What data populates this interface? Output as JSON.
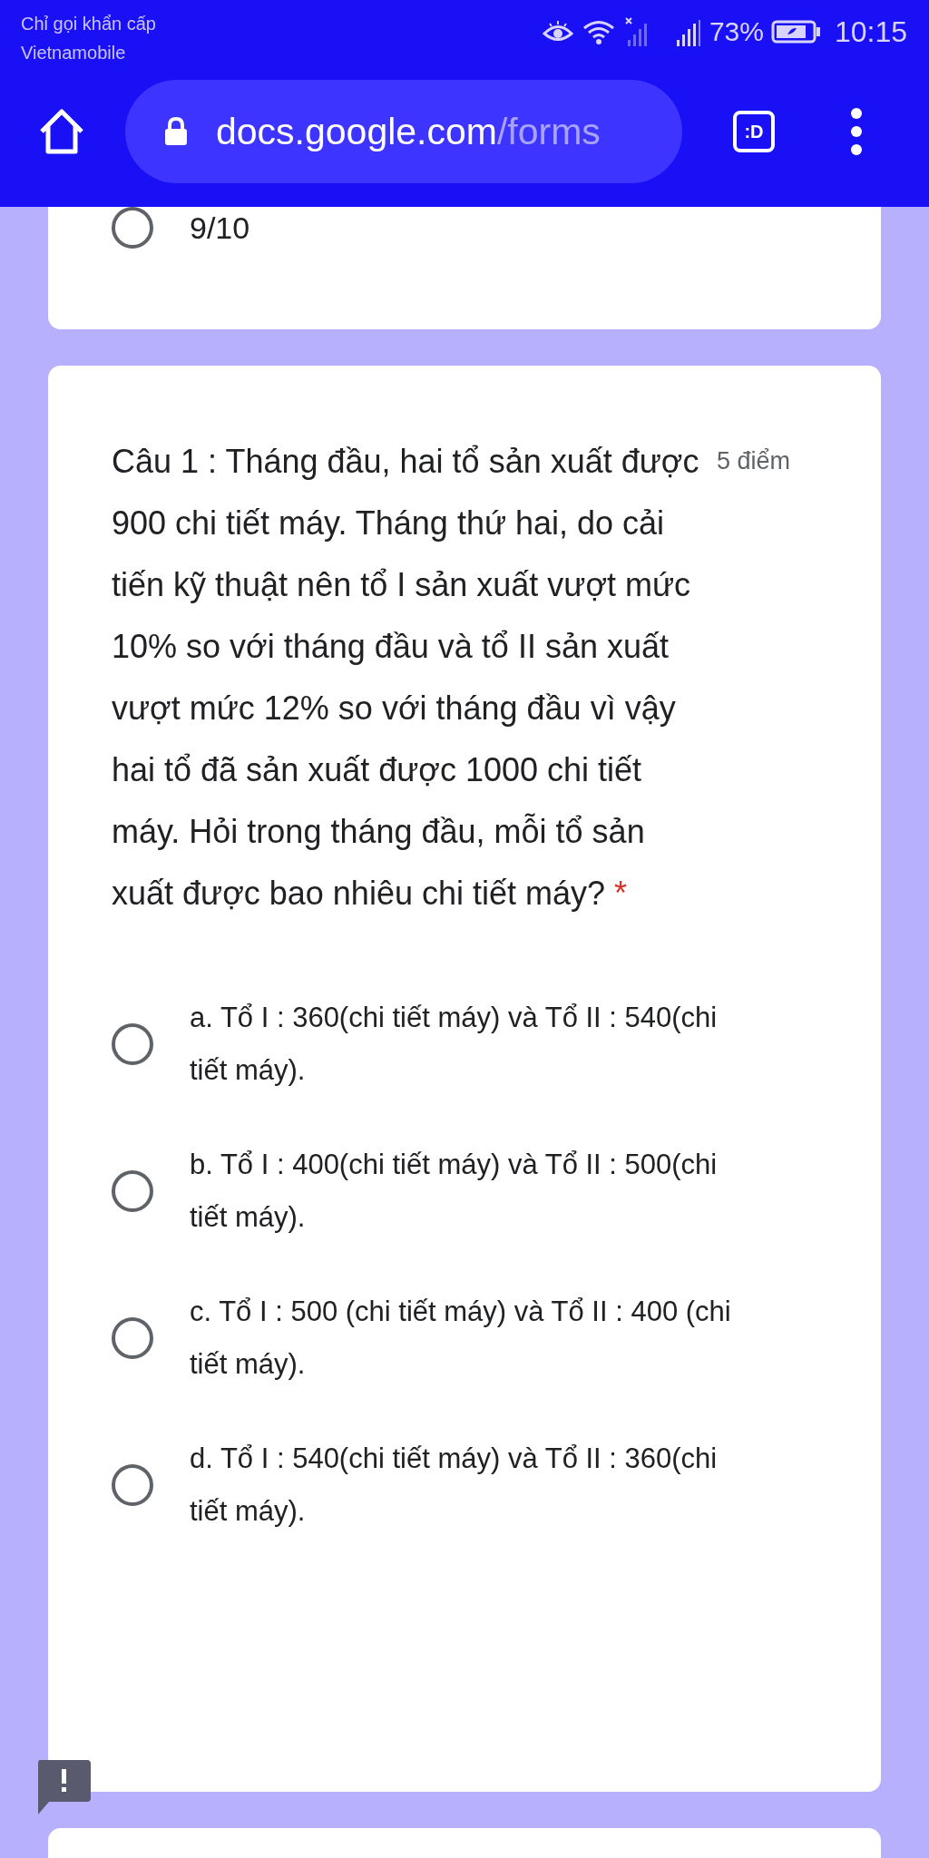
{
  "status_bar": {
    "carrier_lines": [
      "Chỉ gọi khẩn cấp",
      "Vietnamobile"
    ],
    "battery_text": "73%",
    "time": "10:15"
  },
  "browser": {
    "url_domain": "docs.google.com",
    "url_path": "/forms",
    "tab_count": ":D"
  },
  "previous_question": {
    "options": [
      {
        "label": "9/10",
        "selected": false
      }
    ]
  },
  "question": {
    "text": "Câu 1 : Tháng đầu, hai tổ sản xuất được 900 chi tiết máy. Tháng thứ hai, do cải tiến kỹ thuật nên tổ I sản xuất vượt mức 10% so với tháng đầu và tổ II sản xuất vượt mức 12% so với tháng đầu vì vậy hai tổ đã sản xuất được 1000 chi tiết máy. Hỏi trong tháng đầu, mỗi tổ sản xuất được bao nhiêu chi tiết máy?",
    "required_mark": "*",
    "points": "5 điểm",
    "options": [
      {
        "label": "a. Tổ I : 360(chi tiết máy) và Tổ II : 540(chi tiết máy).",
        "selected": false
      },
      {
        "label": "b. Tổ I : 400(chi tiết máy) và Tổ II : 500(chi tiết máy).",
        "selected": false
      },
      {
        "label": "c. Tổ I : 500 (chi tiết máy) và Tổ II : 400 (chi tiết máy).",
        "selected": false
      },
      {
        "label": "d. Tổ I : 540(chi tiết máy) và Tổ II : 360(chi tiết máy).",
        "selected": false
      }
    ]
  }
}
